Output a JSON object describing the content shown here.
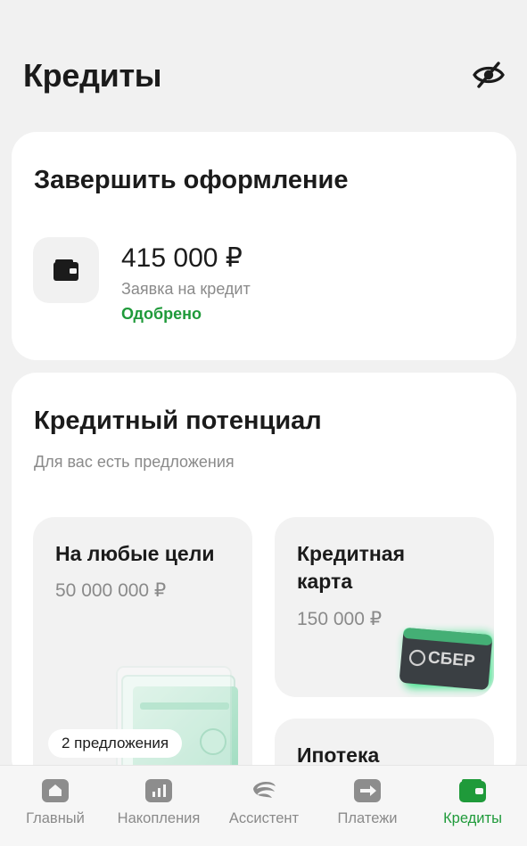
{
  "header": {
    "title": "Кредиты",
    "eye_icon": "eye-off-icon"
  },
  "finish": {
    "title": "Завершить оформление",
    "icon": "wallet-icon",
    "amount": "415 000 ₽",
    "subtitle": "Заявка на кредит",
    "status": "Одобрено",
    "status_color": "#1f9a3a"
  },
  "potential": {
    "title": "Кредитный потенциал",
    "subtitle": "Для вас есть предложения",
    "offers": [
      {
        "title": "На любые цели",
        "amount": "50 000 000 ₽",
        "badge": "2 предложения"
      },
      {
        "title": "Кредитная карта",
        "amount": "150 000 ₽",
        "card_text": "СБЕР"
      },
      {
        "title": "Ипотека"
      }
    ]
  },
  "tabbar": {
    "accent": "#1f9a3a",
    "items": [
      {
        "label": "Главный",
        "icon": "home-icon"
      },
      {
        "label": "Накопления",
        "icon": "savings-chart-icon"
      },
      {
        "label": "Ассистент",
        "icon": "assistant-icon"
      },
      {
        "label": "Платежи",
        "icon": "payments-arrow-icon"
      },
      {
        "label": "Кредиты",
        "icon": "wallet-icon",
        "active": true
      }
    ]
  }
}
